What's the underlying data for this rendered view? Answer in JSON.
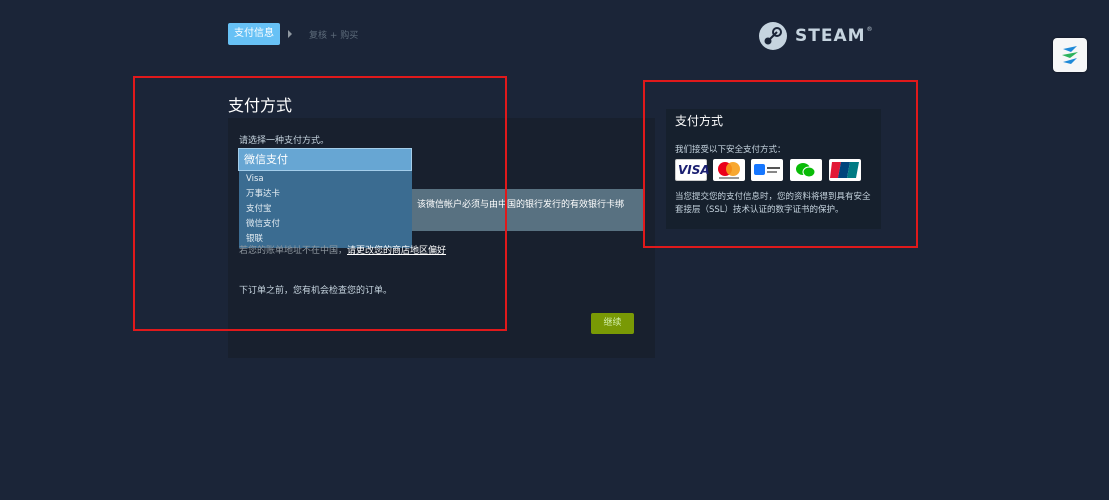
{
  "breadcrumb": {
    "step_active": "支付信息",
    "step_next": "复核 + 购买"
  },
  "logo": {
    "text": "STEAM",
    "reg": "®"
  },
  "payment": {
    "title": "支付方式",
    "choose_label": "请选择一种支付方式。",
    "selected": "微信支付",
    "options": [
      "Visa",
      "万事达卡",
      "支付宝",
      "微信支付",
      "银联"
    ],
    "wechat_note": "该微信帐户必须与由中国的银行发行的有效银行卡绑",
    "address_prefix": "若您的账单地址不在中国，",
    "address_link": "请更改您的商店地区偏好",
    "order_note": "下订单之前，您有机会检查您的订单。",
    "continue_label": "继续"
  },
  "side": {
    "title": "支付方式",
    "accept_text": "我们接受以下安全支付方式：",
    "icons": [
      "visa-icon",
      "mastercard-icon",
      "alipay-icon",
      "wechat-pay-icon",
      "unionpay-icon"
    ],
    "visa_label": "VISA",
    "secure_text": "当您提交您的支付信息时，您的资料将得到具有安全套接层（SSL）技术认证的数字证书的保护。"
  },
  "colors": {
    "background": "#1b2538",
    "accent_blue": "#67c1f5",
    "continue_green": "#799905",
    "annotation_red": "#e0191b"
  }
}
